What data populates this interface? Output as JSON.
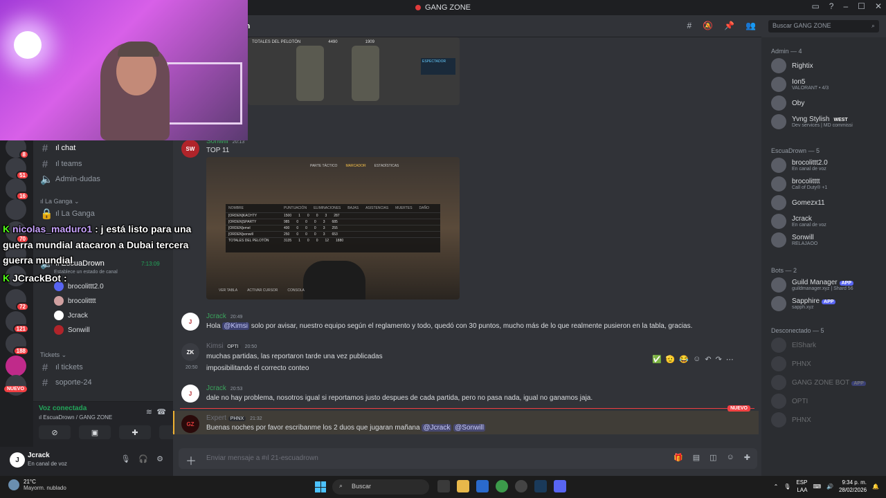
{
  "window": {
    "title": "GANG ZONE"
  },
  "servers": {
    "badges": [
      "8",
      "51",
      "16",
      "70",
      "72",
      "121",
      "188"
    ],
    "nuevo": "NUEVO"
  },
  "channels": {
    "items": [
      {
        "label": "ıl chat",
        "active": true
      },
      {
        "label": "ıl teams"
      },
      {
        "label": "Admin-dudas",
        "voice": true
      },
      {
        "label": "ıl La Ganga",
        "locked": true
      }
    ],
    "cat_la_ganga": "ıl La Ganga",
    "voice_channel": "ıl EscuaDrown",
    "voice_timer": "7:13:09",
    "voice_status": "Establece un estado de canal",
    "voice_users": [
      "brocolittt2.0",
      "brocolitttt",
      "Jcrack",
      "Sonwill"
    ],
    "cat_tickets": "Tickets",
    "tickets": [
      "ıl tickets",
      "soporte-24"
    ]
  },
  "voice_panel": {
    "status": "Voz conectada",
    "sub": "ıl EscuaDrown / GANG ZONE"
  },
  "user_panel": {
    "name": "Jcrack",
    "status": "En canal de voz"
  },
  "chat": {
    "channel_name": "ıl 21-escuadrown",
    "search_placeholder": "Buscar GANG ZONE",
    "input_placeholder": "Enviar mensaje a #ıl 21-escuadrown",
    "messages": [
      {
        "author": "Sonwill",
        "time": "20:13",
        "text": "TOP 11"
      },
      {
        "author": "Jcrack",
        "time": "20:49",
        "pre": "Hola ",
        "mention": "@Kimsi",
        "post": " solo por avisar,  nuestro equipo según el reglamento y todo, quedó con 30 puntos, mucho más de lo que realmente pusieron en la tabla, gracias."
      },
      {
        "author": "Kimsi",
        "badge": "OPTI",
        "time": "20:50",
        "text": "muchas partidas, las reportaron tarde una vez publicadas",
        "text2": "imposibilitando el correcto conteo",
        "time2": "20:50"
      },
      {
        "author": "Jcrack",
        "time": "20:53",
        "text": "dale no hay problema, nosotros igual si reportamos justo despues de cada partida, pero no pasa nada, igual no ganamos jaja."
      },
      {
        "author": "Expert",
        "badge": "PHNX",
        "time": "21:32",
        "text": "Buenas noches por favor escribanme los 2 duos que jugaran mañana ",
        "mention1": "@Jcrack",
        "mention2": "@Sonwill"
      }
    ],
    "nuevo": "NUEVO",
    "img_top": {
      "label": "TOTALES DEL PELOTÓN",
      "vals": [
        "4490",
        "5",
        "5",
        "0",
        "8",
        "1909"
      ],
      "note": "ESPECTADOR"
    },
    "img_main": {
      "tabs": [
        "PARTE TÁCTICO",
        "MARCADOR",
        "ESTADÍSTICAS"
      ],
      "headers": [
        "NOMBRE",
        "PUNTUACIÓN",
        "ELIMINACIONES",
        "BAJAS",
        "ASISTENCIAS",
        "MUERTES",
        "DAÑO"
      ],
      "rows": [
        [
          "[ORDEN]KACHTY",
          "1500",
          "1",
          "0",
          "0",
          "3",
          "287"
        ],
        [
          "[ORDEN]SPARTY",
          "985",
          "0",
          "0",
          "0",
          "3",
          "685"
        ],
        [
          "[ORDEN]emel",
          "400",
          "0",
          "0",
          "0",
          "3",
          "255"
        ],
        [
          "[ORDEN]sonwill",
          "250",
          "0",
          "0",
          "0",
          "3",
          "653"
        ],
        [
          "TOTALES DEL PELOTÓN",
          "3135",
          "1",
          "0",
          "0",
          "12",
          "1880"
        ]
      ],
      "footer": [
        "VER TABLA",
        "ACTIVAR CURSOR",
        "CONSOLA"
      ]
    }
  },
  "members": {
    "cat_admin": "Admin — 4",
    "admins": [
      {
        "name": "Rightix",
        "sub": ""
      },
      {
        "name": "Ion5",
        "sub": "VALORANT • 4/3"
      },
      {
        "name": "Oby",
        "sub": ""
      },
      {
        "name": "Yvng Stylish",
        "sub": "Dev services | MD commissi",
        "tag": "WEST"
      }
    ],
    "cat_escuadrown": "EscuaDrown — 5",
    "escuadrown": [
      {
        "name": "brocolittt2.0",
        "sub": "En canal de voz"
      },
      {
        "name": "brocolitttt",
        "sub": "Call of Duty® +1"
      },
      {
        "name": "Gomezx11",
        "sub": ""
      },
      {
        "name": "Jcrack",
        "sub": "En canal de voz"
      },
      {
        "name": "Sonwill",
        "sub": "RELAJAOO"
      }
    ],
    "cat_bots": "Bots — 2",
    "bots": [
      {
        "name": "Guild Manager",
        "badge": "APP",
        "sub": "guildmanager.xyz | Shard 56"
      },
      {
        "name": "Sapphire",
        "badge": "APP",
        "sub": "sapph.xyz"
      }
    ],
    "cat_offline": "Desconectado — 5",
    "offline": [
      {
        "name": "ElShark",
        "sub": ""
      },
      {
        "name": "PHNX",
        "sub": ""
      },
      {
        "name": "GANG ZONE BOT",
        "badge": "APP"
      },
      {
        "name": "OPTI",
        "sub": ""
      },
      {
        "name": "PHNX",
        "sub": ""
      }
    ]
  },
  "overlay": {
    "user1": "nicolas_maduro1",
    "msg1a": ": j está listo para una",
    "msg1b": "guerra mundial atacaron a Dubai tercera",
    "msg1c": "guerra mundial",
    "user2": "JCrackBot",
    "msg2": ":"
  },
  "taskbar": {
    "temp": "21°C",
    "weather": "Mayorm. nublado",
    "search": "Buscar",
    "lang1": "ESP",
    "lang2": "LAA",
    "time": "9:34 p. m.",
    "date": "28/02/2026"
  }
}
